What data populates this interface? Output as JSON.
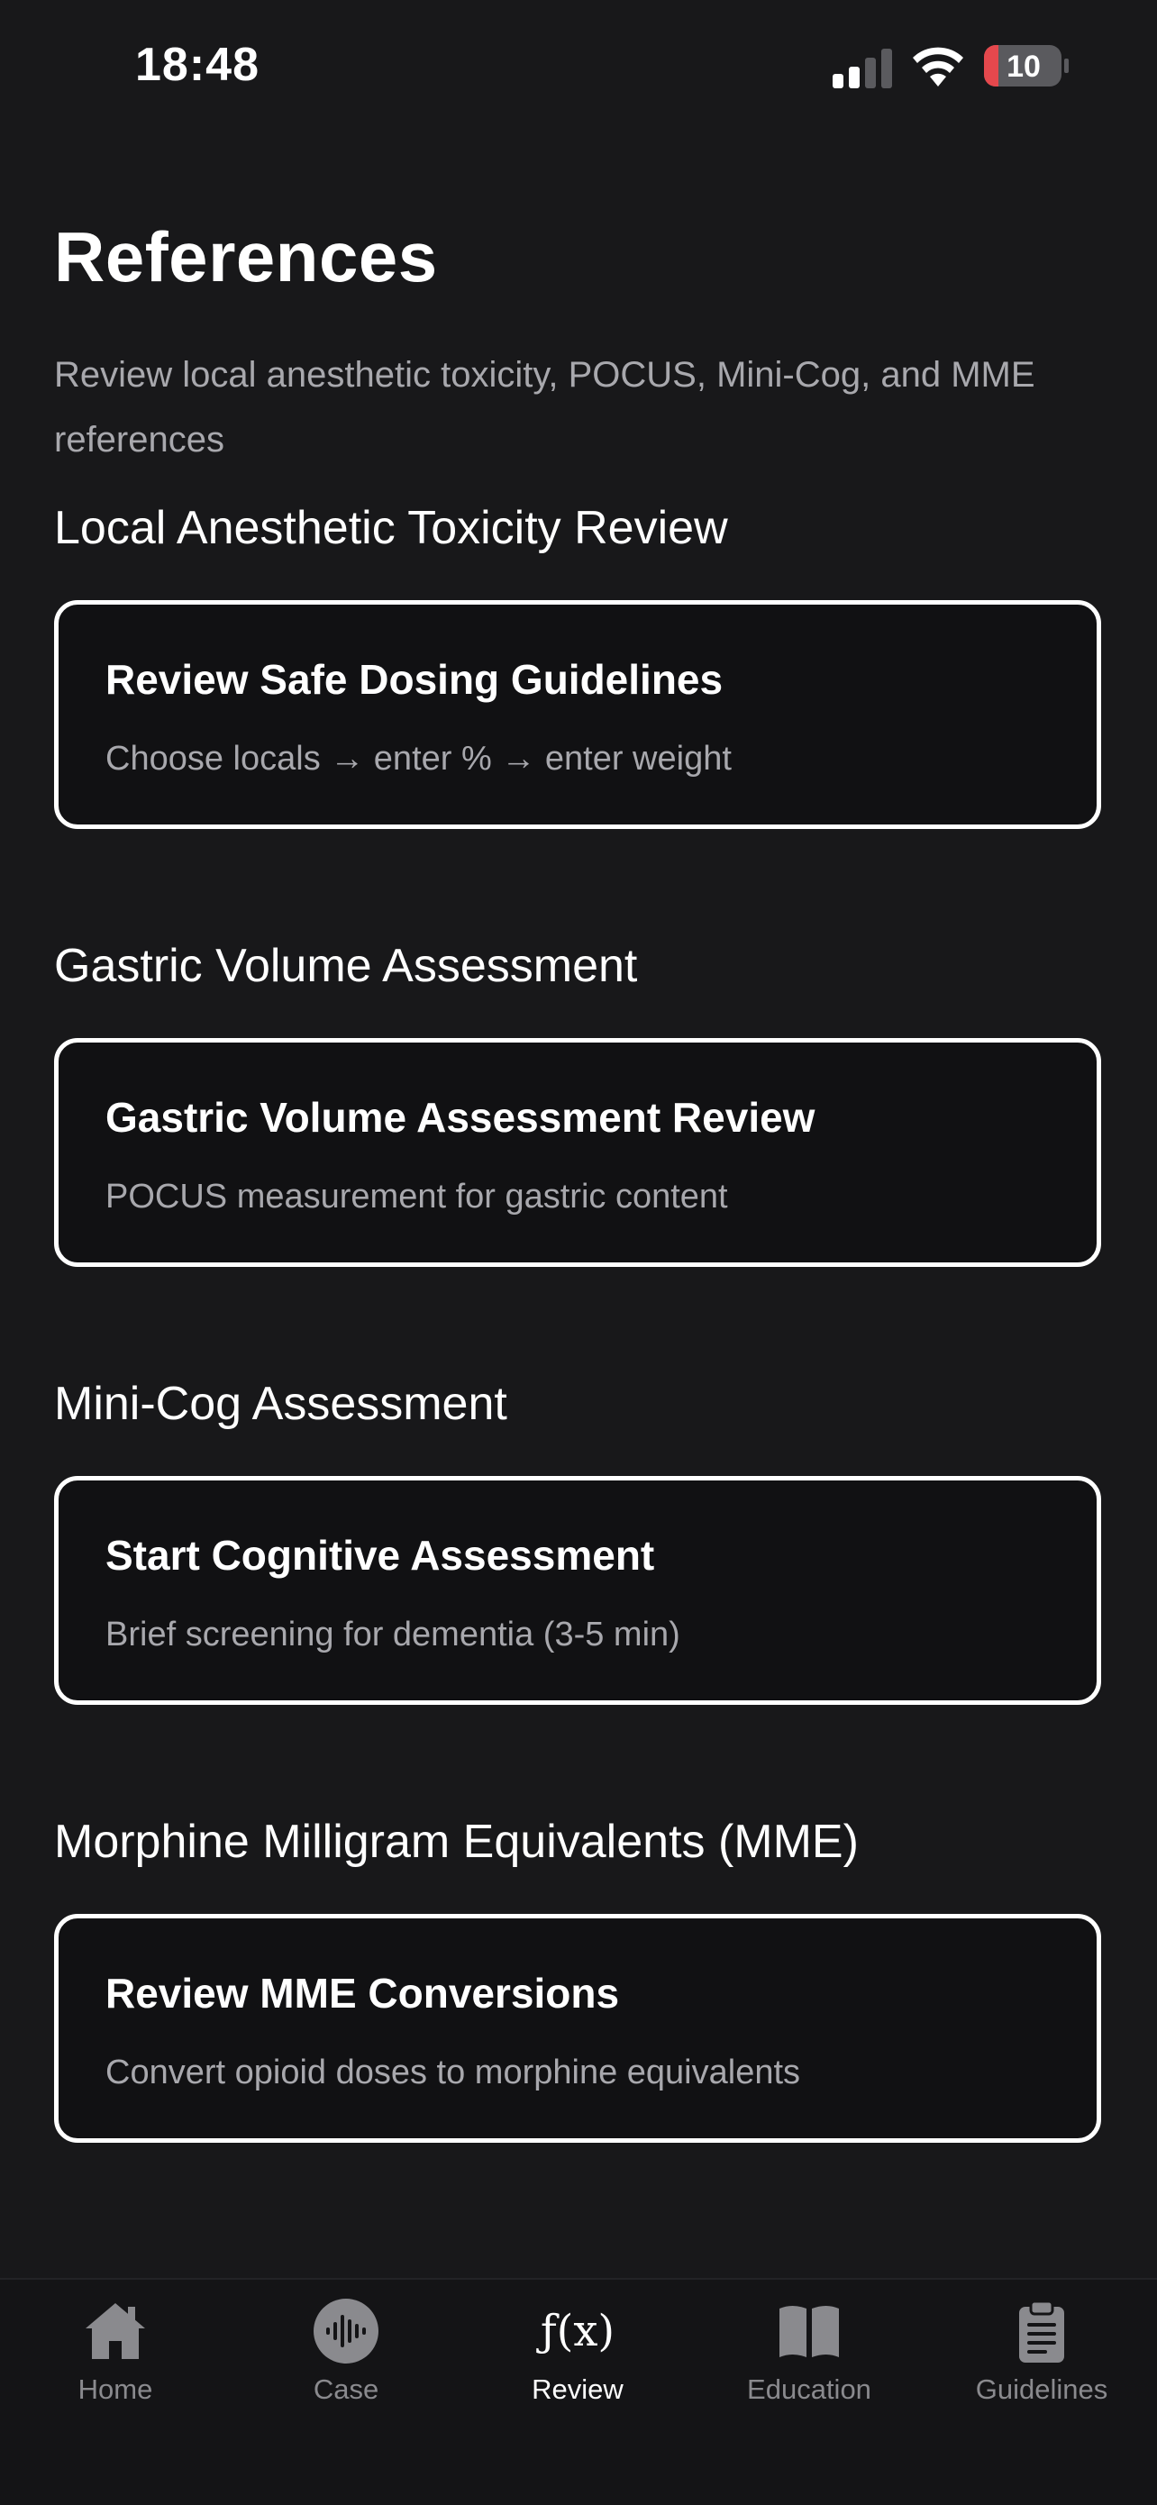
{
  "status_bar": {
    "time": "18:48",
    "battery_level": "10",
    "icons": [
      "signal-icon",
      "wifi-icon",
      "battery-icon"
    ]
  },
  "header": {
    "title": "References",
    "subtitle": "Review local anesthetic toxicity, POCUS, Mini-Cog, and MME references"
  },
  "sections": [
    {
      "title": "Local Anesthetic Toxicity Review",
      "card_title": "Review Safe Dosing Guidelines",
      "card_desc": "Choose locals → enter % → enter weight"
    },
    {
      "title": "Gastric Volume Assessment",
      "card_title": "Gastric Volume Assessment Review",
      "card_desc": "POCUS measurement for gastric content"
    },
    {
      "title": "Mini-Cog Assessment",
      "card_title": "Start Cognitive Assessment",
      "card_desc": "Brief screening for dementia (3-5 min)"
    },
    {
      "title": "Morphine Milligram Equivalents (MME)",
      "card_title": "Review MME Conversions",
      "card_desc": "Convert opioid doses to morphine equivalents"
    }
  ],
  "tab_bar": {
    "tabs": [
      {
        "label": "Home",
        "icon": "house-icon",
        "active": false
      },
      {
        "label": "Case",
        "icon": "waveform-icon",
        "active": false
      },
      {
        "label": "Review",
        "icon": "function-icon",
        "icon_text": "ƒ(x)",
        "active": true
      },
      {
        "label": "Education",
        "icon": "book-icon",
        "active": false
      },
      {
        "label": "Guidelines",
        "icon": "clipboard-icon",
        "active": false
      }
    ]
  },
  "colors": {
    "background": "#18181a",
    "card_border": "#ffffff",
    "muted_text": "#a8a8ad",
    "tab_inactive": "#8a8a8e",
    "battery_low": "#e5484d"
  }
}
